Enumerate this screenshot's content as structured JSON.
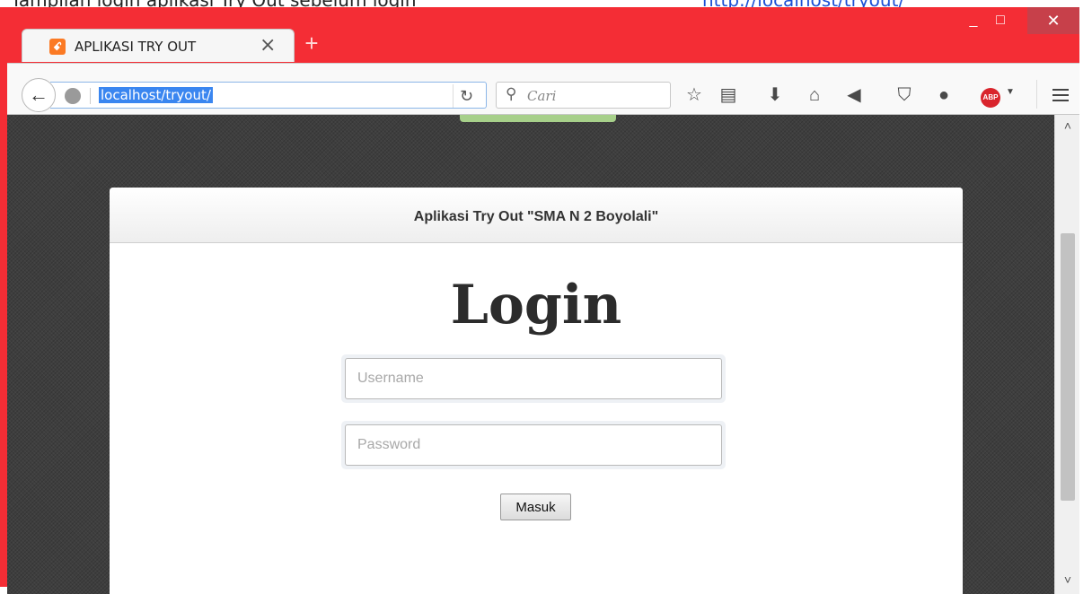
{
  "document": {
    "text_above": "Tampilan login aplikasi Try Out sebelum login",
    "link_text": "http://localhost/tryout/"
  },
  "browser": {
    "tab": {
      "title": "APLIKASI TRY OUT",
      "close_glyph": "×",
      "favicon": "xampp-icon"
    },
    "new_tab_glyph": "+",
    "window_buttons": {
      "minimize": "_",
      "maximize": "□",
      "close": "✕"
    },
    "address_bar": {
      "url": "localhost/tryout/"
    },
    "search_bar": {
      "placeholder": "Cari"
    },
    "toolbar_icons": [
      "bookmark-star-icon",
      "reading-list-icon",
      "download-icon",
      "home-icon",
      "pocket-send-icon",
      "shield-icon",
      "chat-icon",
      "adblock-plus-icon",
      "menu-icon"
    ],
    "abp_label": "ABP"
  },
  "page": {
    "panel_title": "Aplikasi Try Out \"SMA N 2 Boyolali\"",
    "login_heading": "Login",
    "username_placeholder": "Username",
    "password_placeholder": "Password",
    "submit_label": "Masuk"
  },
  "colors": {
    "window_frame": "#f42d35",
    "url_selection": "#3a86f0",
    "accent_green": "#a7d08a"
  }
}
